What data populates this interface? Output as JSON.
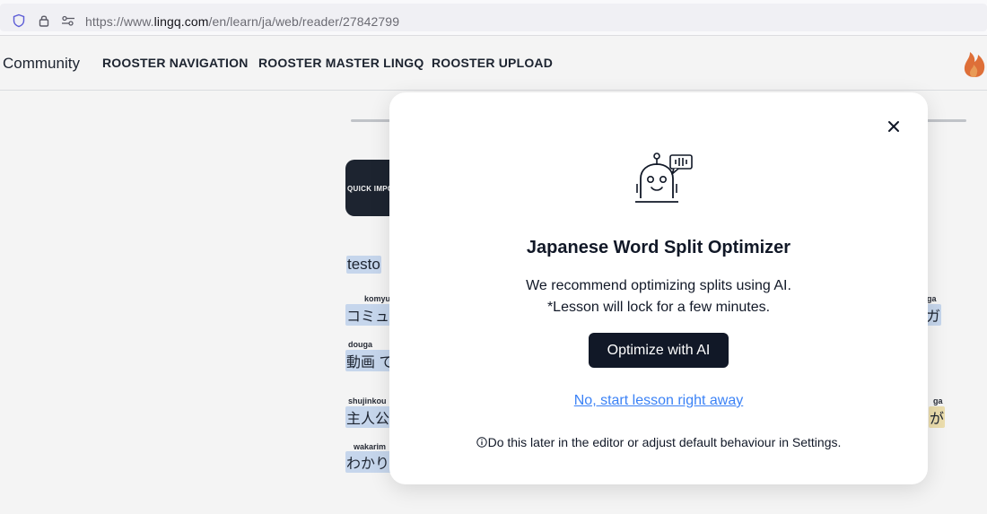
{
  "browser": {
    "url_prefix": "https://www.",
    "url_host": "lingq.com",
    "url_path": "/en/learn/ja/web/reader/27842799",
    "icons": [
      "shield-icon",
      "lock-icon",
      "permissions-icon"
    ]
  },
  "header": {
    "community": "Community",
    "nav": [
      "ROOSTER NAVIGATION",
      "ROOSTER MASTER LINGQ",
      "ROOSTER UPLOAD"
    ],
    "streak_icon": "fire-icon"
  },
  "reader": {
    "quick_import": "QUICK IMPORT",
    "title_word": "testo",
    "rows": [
      {
        "ruby": "komyu",
        "text": "コミュニ"
      },
      {
        "ruby": "douga",
        "text": "動画 て"
      },
      {
        "ruby": "shujinkou",
        "text": "主人公"
      },
      {
        "ruby": "wakarim",
        "text": "わかりま"
      }
    ],
    "right_rows": [
      {
        "ruby": "ga",
        "text": "ガ"
      },
      {
        "ruby": "ga",
        "text": "が"
      }
    ]
  },
  "modal": {
    "icon": "robot-icon",
    "title": "Japanese Word Split Optimizer",
    "desc_line1": "We recommend optimizing splits using AI.",
    "desc_line2": "*Lesson will lock for a few minutes.",
    "optimize_label": "Optimize with AI",
    "skip_label": "No, start lesson right away",
    "footnote": "Do this later in the editor or adjust default behaviour in Settings."
  },
  "colors": {
    "accent_dark": "#111827",
    "link_blue": "#3b82f6",
    "word_highlight": "#cfe0f7",
    "word_highlight_yellow": "#f6e7b5",
    "fire": "#e8743b"
  }
}
